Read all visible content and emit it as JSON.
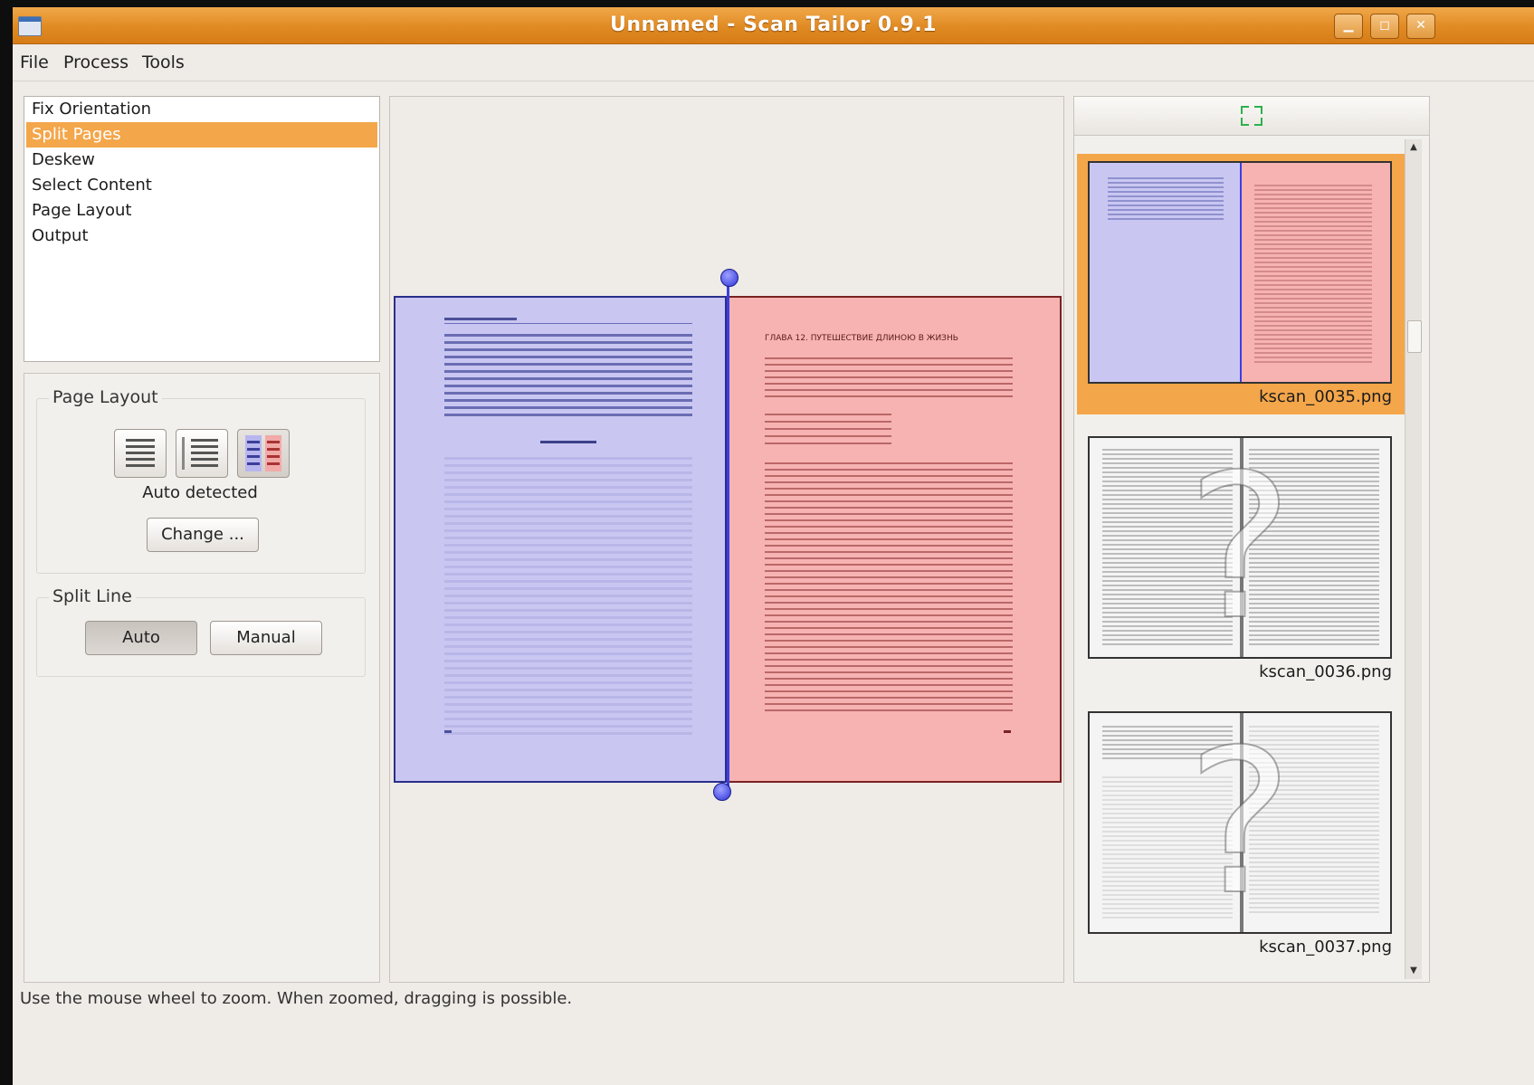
{
  "window": {
    "title": "Unnamed - Scan Tailor 0.9.1"
  },
  "menu": [
    "File",
    "Process",
    "Tools"
  ],
  "filters": {
    "items": [
      "Fix Orientation",
      "Split Pages",
      "Deskew",
      "Select Content",
      "Page Layout",
      "Output"
    ],
    "selected_index": 1
  },
  "options": {
    "page_layout": {
      "title": "Page Layout",
      "status": "Auto detected",
      "change_label": "Change ..."
    },
    "split_line": {
      "title": "Split Line",
      "auto_label": "Auto",
      "manual_label": "Manual"
    }
  },
  "thumbnails": [
    {
      "name": "kscan_0035.png",
      "selected": true
    },
    {
      "name": "kscan_0036.png",
      "selected": false
    },
    {
      "name": "kscan_0037.png",
      "selected": false
    }
  ],
  "status": "Use the mouse wheel to zoom.  When zoomed, dragging is possible.",
  "book": {
    "right_heading": "ГЛАВА 12. ПУТЕШЕСТВИЕ ДЛИНОЮ В ЖИЗНЬ"
  },
  "colors": {
    "accent": "#f4a64a",
    "left_page": "#c9c7f2",
    "right_page": "#f6b3b1",
    "split_line": "#3a3fe0"
  }
}
